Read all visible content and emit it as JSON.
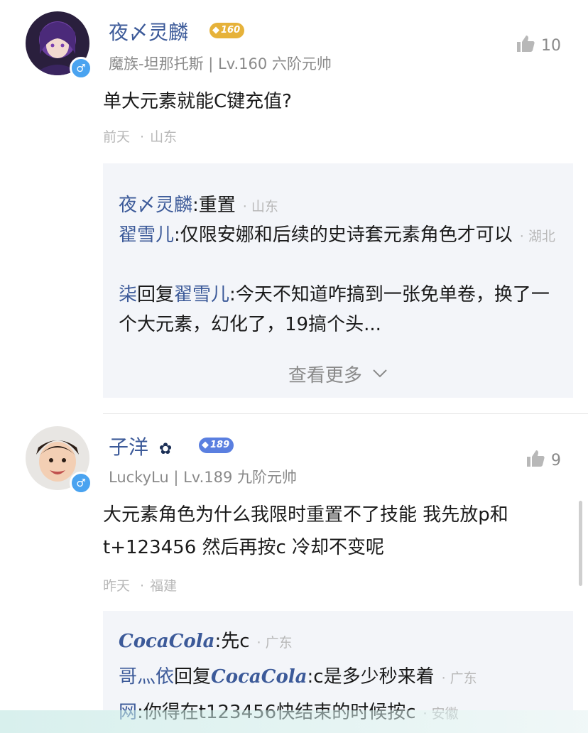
{
  "comments": [
    {
      "username": "夜〆灵麟",
      "badge_level": "160",
      "badge_color": "#e6b23a",
      "sub_info": "魔族-坦那托斯 | Lv.160 六阶元帅",
      "like_count": "10",
      "text": "单大元素就能C键充值?",
      "time": "前天",
      "location": "山东",
      "replies": [
        {
          "name": "夜〆灵麟",
          "sep": ":",
          "text": "重置",
          "location": "· 山东"
        },
        {
          "name": "翟雪儿",
          "sep": ":",
          "text": "仅限安娜和后续的史诗套元素角色才可以",
          "location": "· 湖北"
        },
        {
          "name": "柒",
          "reply_word": "回复",
          "target": "翟雪儿",
          "sep": ":",
          "text": "今天不知道咋搞到一张免单卷，换了一个大元素，幻化了，19搞个头...",
          "location": ""
        }
      ],
      "more_label": "查看更多"
    },
    {
      "username": "子洋",
      "username_suffix": "✿",
      "badge_level": "189",
      "badge_color": "#5a7fe0",
      "sub_info": "LuckyLu | Lv.189 九阶元帅",
      "like_count": "9",
      "text": "大元素角色为什么我限时重置不了技能  我先放p和t+123456   然后再按c  冷却不变呢",
      "time": "昨天",
      "location": "福建",
      "replies": [
        {
          "name": "CocaCola",
          "sep": ":",
          "text": "先c",
          "location": "· 广东"
        },
        {
          "name": "哥灬依",
          "reply_word": "回复",
          "target": "CocaCola",
          "sep": ":",
          "text": "c是多少秒来着",
          "location": "· 广东"
        },
        {
          "name": "网",
          "sep": ":",
          "text": "你得在t123456快结束的时候按c",
          "location": "· 安徽"
        }
      ]
    }
  ],
  "gender_symbol": "♂",
  "icons": {
    "like": "thumbs-up-icon",
    "expand": "chevron-down-icon",
    "gender": "male-icon"
  }
}
